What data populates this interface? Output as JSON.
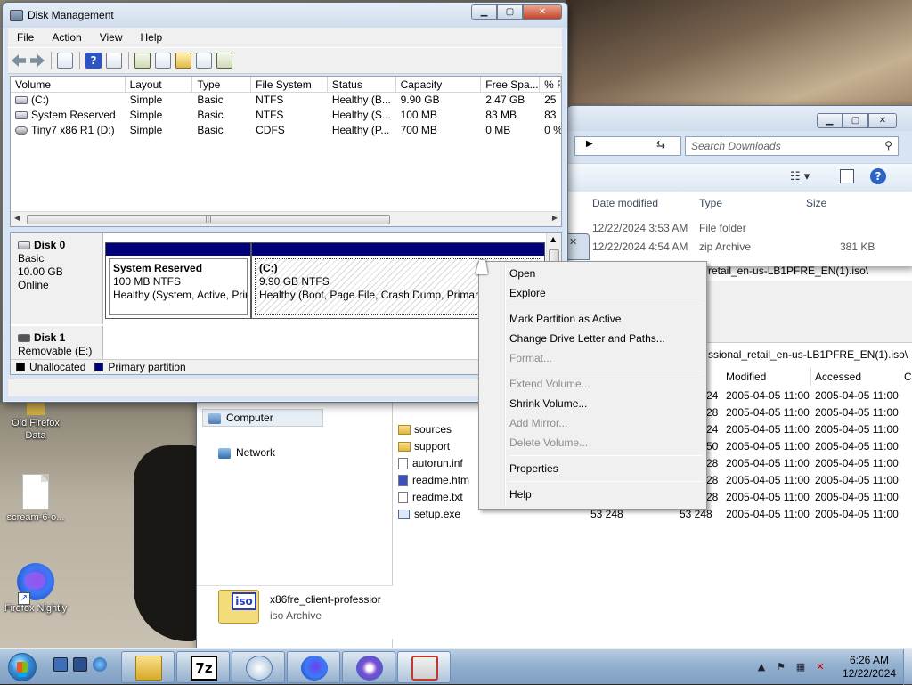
{
  "desktop": {
    "icons": [
      {
        "label": "Old Firefox Data"
      },
      {
        "label": "scream-6-o..."
      },
      {
        "label": "Firefox Nightly"
      }
    ]
  },
  "disk_management": {
    "title": "Disk Management",
    "menu": [
      "File",
      "Action",
      "View",
      "Help"
    ],
    "columns": [
      "Volume",
      "Layout",
      "Type",
      "File System",
      "Status",
      "Capacity",
      "Free Spa...",
      "% F"
    ],
    "volumes": [
      {
        "volume": "(C:)",
        "layout": "Simple",
        "type": "Basic",
        "fs": "NTFS",
        "status": "Healthy (B...",
        "capacity": "9.90 GB",
        "free": "2.47 GB",
        "pct": "25"
      },
      {
        "volume": "System Reserved",
        "layout": "Simple",
        "type": "Basic",
        "fs": "NTFS",
        "status": "Healthy (S...",
        "capacity": "100 MB",
        "free": "83 MB",
        "pct": "83"
      },
      {
        "volume": "Tiny7 x86 R1 (D:)",
        "layout": "Simple",
        "type": "Basic",
        "fs": "CDFS",
        "status": "Healthy (P...",
        "capacity": "700 MB",
        "free": "0 MB",
        "pct": "0 %"
      }
    ],
    "disk0": {
      "name": "Disk 0",
      "type": "Basic",
      "size": "10.00 GB",
      "state": "Online",
      "partitions": [
        {
          "name": "System Reserved",
          "size": "100 MB NTFS",
          "status": "Healthy (System, Active, Prir"
        },
        {
          "name": "(C:)",
          "size": "9.90 GB NTFS",
          "status": "Healthy (Boot, Page File, Crash Dump, Primary"
        }
      ]
    },
    "disk1": {
      "name": "Disk 1",
      "type": "Removable (E:)"
    },
    "legend": [
      "Unallocated",
      "Primary partition"
    ],
    "legend_colors": {
      "unallocated": "#000000",
      "primary": "#00007a"
    }
  },
  "context_menu": {
    "items": [
      {
        "label": "Open",
        "disabled": false
      },
      {
        "label": "Explore",
        "disabled": false
      },
      {
        "label": "Mark Partition as Active",
        "disabled": false
      },
      {
        "label": "Change Drive Letter and Paths...",
        "disabled": false
      },
      {
        "label": "Format...",
        "disabled": true
      },
      {
        "label": "Extend Volume...",
        "disabled": true
      },
      {
        "label": "Shrink Volume...",
        "disabled": false
      },
      {
        "label": "Add Mirror...",
        "disabled": true
      },
      {
        "label": "Delete Volume...",
        "disabled": true
      },
      {
        "label": "Properties",
        "disabled": false
      },
      {
        "label": "Help",
        "disabled": false
      }
    ]
  },
  "explorer": {
    "search_placeholder": "Search Downloads",
    "columns": [
      "Date modified",
      "Type",
      "Size"
    ],
    "rows": [
      {
        "date": "12/22/2024 3:53 AM",
        "type": "File folder",
        "size": ""
      },
      {
        "date": "12/22/2024 4:54 AM",
        "type": "zip Archive",
        "size": "381 KB"
      }
    ]
  },
  "sevenzip": {
    "path1": "retail_en-us-LB1PFRE_EN(1).iso\\",
    "path2": "ssional_retail_en-us-LB1PFRE_EN(1).iso\\",
    "columns": [
      "Modified",
      "Accessed",
      "Cr"
    ],
    "nav": [
      {
        "label": "Computer"
      },
      {
        "label": "Network"
      }
    ],
    "files": [
      {
        "name": "",
        "size1": "",
        "size2": "24",
        "modified": "2005-04-05 11:00",
        "accessed": "2005-04-05 11:00"
      },
      {
        "name": "",
        "size1": "",
        "size2": "28",
        "modified": "2005-04-05 11:00",
        "accessed": "2005-04-05 11:00"
      },
      {
        "name": "sources",
        "size1": "",
        "size2": "24",
        "modified": "2005-04-05 11:00",
        "accessed": "2005-04-05 11:00"
      },
      {
        "name": "support",
        "size1": "",
        "size2": "50",
        "modified": "2005-04-05 11:00",
        "accessed": "2005-04-05 11:00"
      },
      {
        "name": "autorun.inf",
        "size1": "",
        "size2": "28",
        "modified": "2005-04-05 11:00",
        "accessed": "2005-04-05 11:00"
      },
      {
        "name": "readme.htm",
        "size1": "",
        "size2": "28",
        "modified": "2005-04-05 11:00",
        "accessed": "2005-04-05 11:00"
      },
      {
        "name": "readme.txt",
        "size1": "",
        "size2": "28",
        "modified": "2005-04-05 11:00",
        "accessed": "2005-04-05 11:00"
      },
      {
        "name": "setup.exe",
        "size1": "53 248",
        "size2": "53 248",
        "modified": "2005-04-05 11:00",
        "accessed": "2005-04-05 11:00"
      }
    ],
    "info": {
      "name": "x86fre_client-professior",
      "type": "iso Archive",
      "icon_text": "iso"
    }
  },
  "taskbar": {
    "sevenzip_label": "7z",
    "clock_time": "6:26 AM",
    "clock_date": "12/22/2024"
  }
}
